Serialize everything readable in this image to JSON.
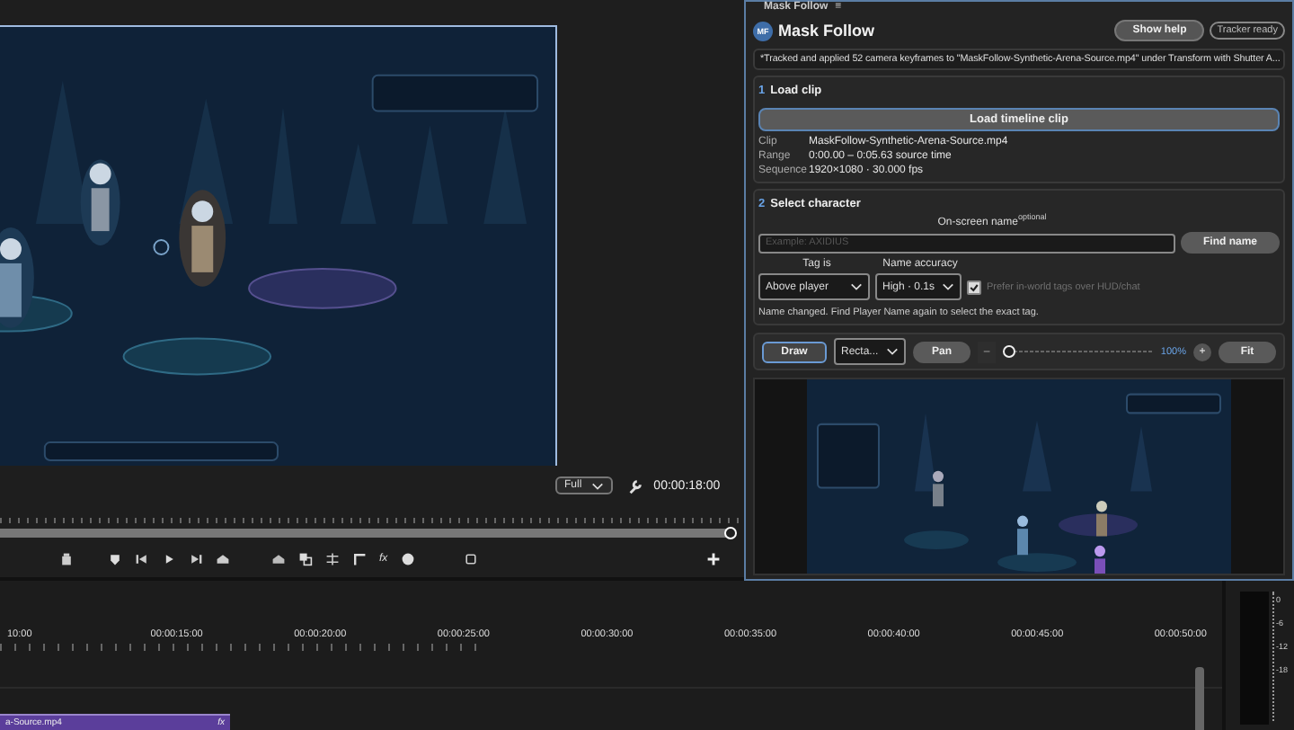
{
  "monitor": {
    "quality": "Full",
    "timecode": "00:00:18:00",
    "fx_label": "fx"
  },
  "panel": {
    "tab_title": "Mask Follow",
    "tab_menu": "≡",
    "logo": "MF",
    "title": "Mask Follow",
    "help_button": "Show help",
    "status_badge": "Tracker ready",
    "message": "*Tracked and applied 52 camera keyframes to \"MaskFollow-Synthetic-Arena-Source.mp4\" under Transform with Shutter A...",
    "load_clip": {
      "step": "1",
      "heading": "Load clip",
      "button": "Load timeline clip",
      "details": [
        {
          "label": "Clip",
          "value": "MaskFollow-Synthetic-Arena-Source.mp4"
        },
        {
          "label": "Range",
          "value": "0:00.00 – 0:05.63 source time"
        },
        {
          "label": "Sequence",
          "value": "1920×1080 · 30.000 fps"
        }
      ]
    },
    "select_character": {
      "step": "2",
      "heading": "Select character",
      "name_label": "On-screen name",
      "name_hint": "optional",
      "name_placeholder": "Example: AXIDIUS",
      "find_button": "Find name",
      "tag_label": "Tag is",
      "tag_value": "Above player",
      "accuracy_label": "Name accuracy",
      "accuracy_value": "High · 0.1s",
      "prefer_checked": true,
      "prefer_label": "Prefer in-world tags over HUD/chat",
      "notice": "Name changed. Find Player Name again to select the exact tag."
    },
    "toolbar": {
      "draw_button": "Draw",
      "draw_selected": true,
      "shape_value": "Recta...",
      "pan_button": "Pan",
      "minus_button": "–",
      "zoom": {
        "level": 0
      },
      "zoom_label": "100%",
      "plus_button": "+",
      "fit_button": "Fit"
    }
  },
  "timeline": {
    "ruler": [
      "10:00",
      "00:00:15:00",
      "00:00:20:00",
      "00:00:25:00",
      "00:00:30:00",
      "00:00:35:00",
      "00:00:40:00",
      "00:00:45:00",
      "00:00:50:00"
    ],
    "clip": {
      "name": "a-Source.mp4",
      "fx": "fx"
    }
  },
  "meter": {
    "labels": [
      "0",
      "-6",
      "-12",
      "-18"
    ]
  }
}
